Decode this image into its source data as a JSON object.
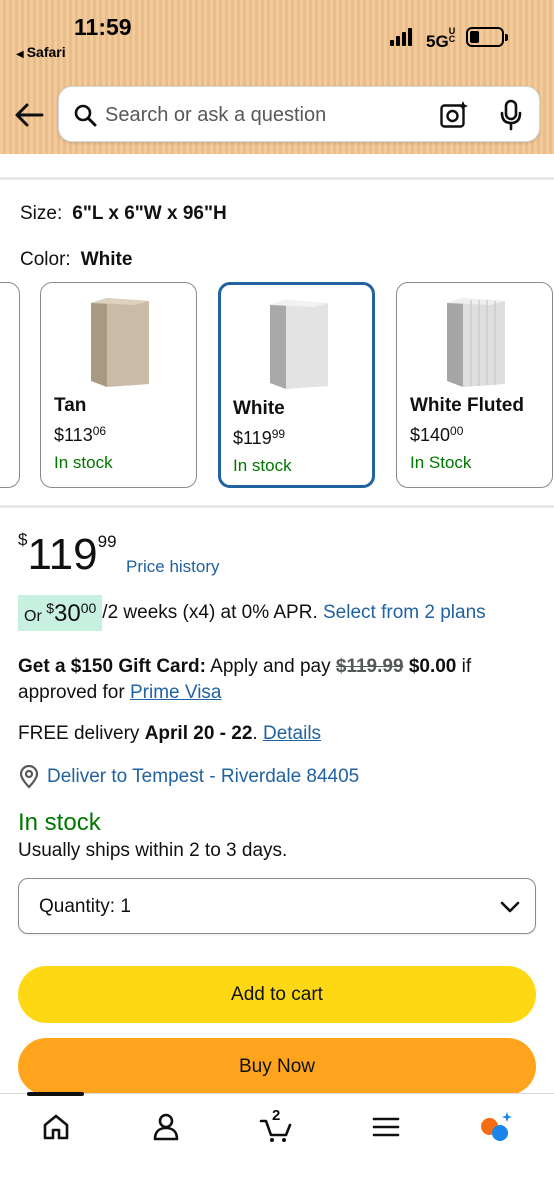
{
  "status_bar": {
    "time": "11:59",
    "back_app": "Safari",
    "network": "5G",
    "network_suffix": "UC"
  },
  "search": {
    "placeholder": "Search or ask a question",
    "value": ""
  },
  "variations": {
    "size_label": "Size:",
    "size_value": "6\"L x 6\"W x 96\"H",
    "color_label": "Color:",
    "color_value": "White",
    "swatches": [
      {
        "name": "Tan",
        "price_whole": "$113",
        "price_fraction": "06",
        "stock": "In stock",
        "color": "#c9bca6",
        "selected": false
      },
      {
        "name": "White",
        "price_whole": "$119",
        "price_fraction": "99",
        "stock": "In stock",
        "color": "#e3e3e3",
        "selected": true
      },
      {
        "name": "White Fluted",
        "price_whole": "$140",
        "price_fraction": "00",
        "stock": "In Stock",
        "color": "#dedede",
        "selected": false
      }
    ]
  },
  "price": {
    "currency": "$",
    "whole": "119",
    "fraction": "99",
    "history_link": "Price history"
  },
  "installment": {
    "prefix": "Or ",
    "currency": "$",
    "amount_whole": "30",
    "amount_fraction": "00",
    "terms": "/2 weeks (x4) at 0% APR.",
    "plans_link": "Select from 2 plans"
  },
  "gift_card": {
    "headline": "Get a $150 Gift Card:",
    "text": " Apply and pay ",
    "old_price": "$119.99",
    "new_price": "$0.00",
    "suffix": " if approved for ",
    "link": "Prime Visa"
  },
  "delivery": {
    "prefix": "FREE delivery ",
    "dates": "April 20 - 22",
    "separator": ". ",
    "details_link": "Details",
    "deliver_to": "Deliver to Tempest - Riverdale 84405"
  },
  "availability": {
    "status": "In stock",
    "ships": "Usually ships within 2 to 3 days."
  },
  "quantity": {
    "label": "Quantity:",
    "value": "1"
  },
  "buttons": {
    "add_to_cart": "Add to cart",
    "buy_now": "Buy Now"
  },
  "nav": {
    "cart_count": "2"
  },
  "colors": {
    "link": "#2162a1",
    "in_stock": "#007600",
    "add_to_cart": "#ffd814",
    "buy_now": "#ffa41c",
    "selected_border": "#2162a1",
    "header": "#f2c48f"
  }
}
